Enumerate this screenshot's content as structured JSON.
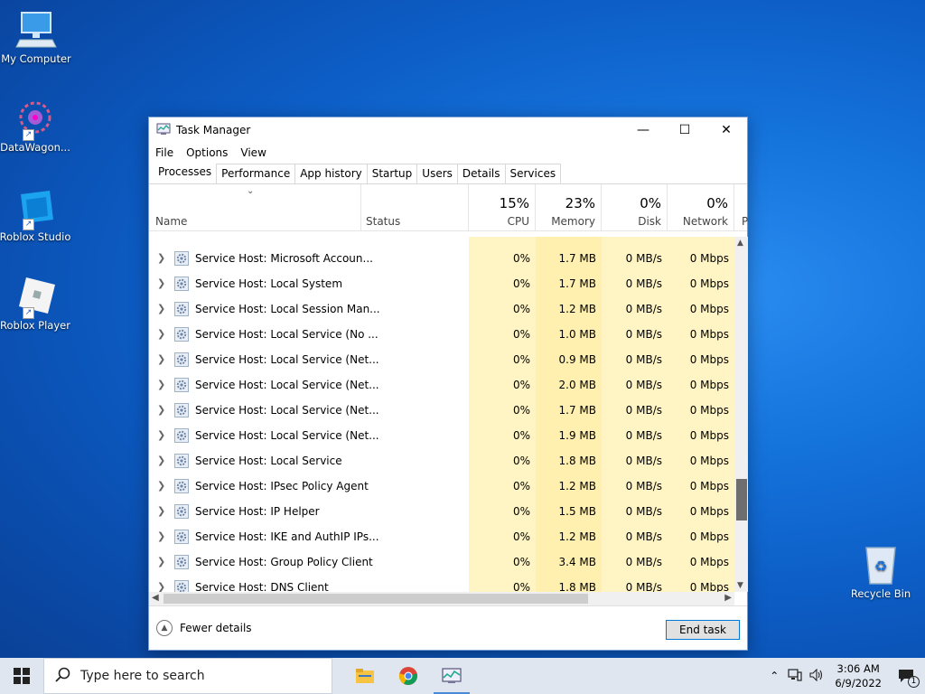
{
  "desktop": {
    "icons": [
      {
        "label": "My Computer"
      },
      {
        "label": "DataWagon..."
      },
      {
        "label": "Roblox Studio"
      },
      {
        "label": "Roblox Player"
      },
      {
        "label": "Recycle Bin"
      }
    ]
  },
  "window": {
    "title": "Task Manager",
    "menu": [
      "File",
      "Options",
      "View"
    ],
    "tabs": [
      "Processes",
      "Performance",
      "App history",
      "Startup",
      "Users",
      "Details",
      "Services"
    ],
    "active_tab": "Processes",
    "columns": {
      "name": "Name",
      "status": "Status",
      "cpu": {
        "pct": "15%",
        "label": "CPU"
      },
      "memory": {
        "pct": "23%",
        "label": "Memory"
      },
      "disk": {
        "pct": "0%",
        "label": "Disk"
      },
      "network": {
        "pct": "0%",
        "label": "Network"
      },
      "power": "P"
    },
    "rows": [
      {
        "name": "Service Host: Microsoft Accoun...",
        "cpu": "0%",
        "memory": "1.7 MB",
        "disk": "0 MB/s",
        "network": "0 Mbps"
      },
      {
        "name": "Service Host: Local System",
        "cpu": "0%",
        "memory": "1.7 MB",
        "disk": "0 MB/s",
        "network": "0 Mbps"
      },
      {
        "name": "Service Host: Local Session Man...",
        "cpu": "0%",
        "memory": "1.2 MB",
        "disk": "0 MB/s",
        "network": "0 Mbps"
      },
      {
        "name": "Service Host: Local Service (No ...",
        "cpu": "0%",
        "memory": "1.0 MB",
        "disk": "0 MB/s",
        "network": "0 Mbps"
      },
      {
        "name": "Service Host: Local Service (Net...",
        "cpu": "0%",
        "memory": "0.9 MB",
        "disk": "0 MB/s",
        "network": "0 Mbps"
      },
      {
        "name": "Service Host: Local Service (Net...",
        "cpu": "0%",
        "memory": "2.0 MB",
        "disk": "0 MB/s",
        "network": "0 Mbps"
      },
      {
        "name": "Service Host: Local Service (Net...",
        "cpu": "0%",
        "memory": "1.7 MB",
        "disk": "0 MB/s",
        "network": "0 Mbps"
      },
      {
        "name": "Service Host: Local Service (Net...",
        "cpu": "0%",
        "memory": "1.9 MB",
        "disk": "0 MB/s",
        "network": "0 Mbps"
      },
      {
        "name": "Service Host: Local Service",
        "cpu": "0%",
        "memory": "1.8 MB",
        "disk": "0 MB/s",
        "network": "0 Mbps"
      },
      {
        "name": "Service Host: IPsec Policy Agent",
        "cpu": "0%",
        "memory": "1.2 MB",
        "disk": "0 MB/s",
        "network": "0 Mbps"
      },
      {
        "name": "Service Host: IP Helper",
        "cpu": "0%",
        "memory": "1.5 MB",
        "disk": "0 MB/s",
        "network": "0 Mbps"
      },
      {
        "name": "Service Host: IKE and AuthIP IPs...",
        "cpu": "0%",
        "memory": "1.2 MB",
        "disk": "0 MB/s",
        "network": "0 Mbps"
      },
      {
        "name": "Service Host: Group Policy Client",
        "cpu": "0%",
        "memory": "3.4 MB",
        "disk": "0 MB/s",
        "network": "0 Mbps"
      },
      {
        "name": "Service Host: DNS Client",
        "cpu": "0%",
        "memory": "1.8 MB",
        "disk": "0 MB/s",
        "network": "0 Mbps"
      }
    ],
    "footer": {
      "fewer_details": "Fewer details",
      "end_task": "End task"
    }
  },
  "taskbar": {
    "search_placeholder": "Type here to search",
    "clock_time": "3:06 AM",
    "clock_date": "6/9/2022",
    "notification_count": "1"
  }
}
